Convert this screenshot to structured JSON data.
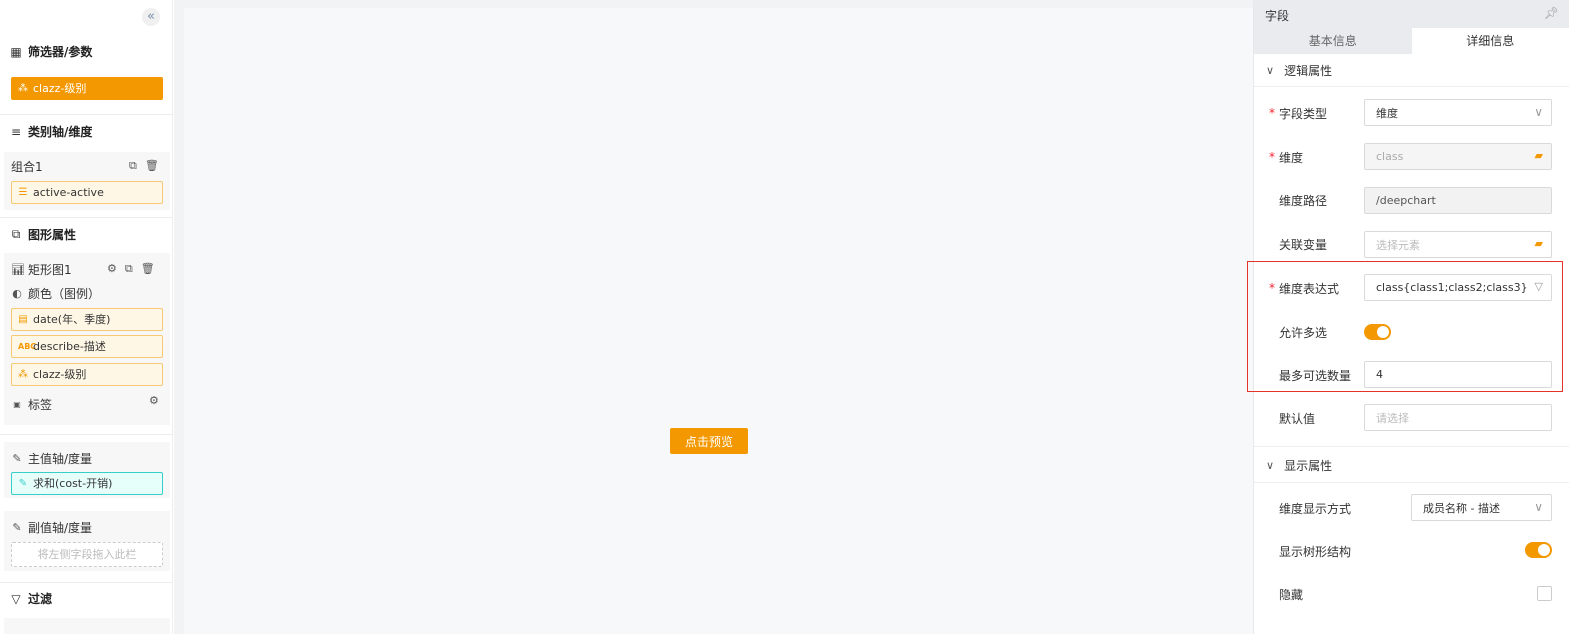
{
  "left": {
    "collapse_icon": "double-chevron-left-icon",
    "filters_title": "筛选器/参数",
    "filter_pill": "clazz-级别",
    "category_title": "类别轴/维度",
    "combo_label": "组合1",
    "combo_pill": "active-active",
    "graphic_title": "图形属性",
    "chart_label": "矩形图1",
    "color_label": "颜色（图例）",
    "color_pills": [
      "date(年、季度)",
      "describe-描述",
      "clazz-级别"
    ],
    "tag_label": "标签",
    "primary_title": "主值轴/度量",
    "primary_pill": "求和(cost-开销)",
    "secondary_title": "副值轴/度量",
    "secondary_placeholder": "将左侧字段拖入此栏",
    "filter_title": "过滤"
  },
  "center": {
    "preview_button": "点击预览"
  },
  "right": {
    "title": "字段",
    "tabs": [
      "基本信息",
      "详细信息"
    ],
    "logic_group": "逻辑属性",
    "field_type_label": "字段类型",
    "field_type_value": "维度",
    "dimension_label": "维度",
    "dimension_value": "class",
    "dim_path_label": "维度路径",
    "dim_path_value": "/deepchart",
    "linked_var_label": "关联变量",
    "linked_var_placeholder": "选择元素",
    "dim_expr_label": "维度表达式",
    "dim_expr_value": "class{class1;class2;class3}",
    "allow_multi_label": "允许多选",
    "allow_multi_value": true,
    "max_select_label": "最多可选数量",
    "max_select_value": "4",
    "default_label": "默认值",
    "default_placeholder": "请选择",
    "display_group": "显示属性",
    "dim_display_label": "维度显示方式",
    "dim_display_value": "成员名称 - 描述",
    "show_tree_label": "显示树形结构",
    "show_tree_value": true,
    "hidden_label": "隐藏",
    "hidden_value": false
  },
  "colors": {
    "accent": "#f39800",
    "highlight_border": "#e5332a"
  }
}
